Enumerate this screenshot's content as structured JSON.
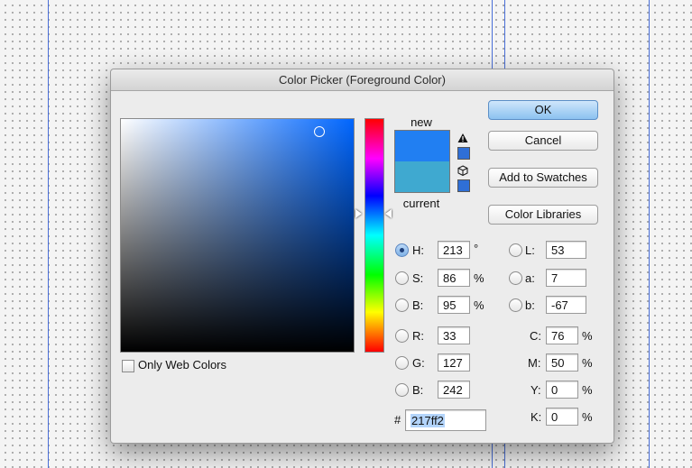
{
  "dialog": {
    "title": "Color Picker (Foreground Color)",
    "colors": {
      "new": "#217ff2",
      "current": "#3fa9d0",
      "gamut_swatch": "#2f6fd6",
      "web_swatch": "#2f6fd6"
    }
  },
  "preview": {
    "new_label": "new",
    "current_label": "current",
    "warning_icon": "warning-triangle-icon",
    "web_icon": "cube-icon"
  },
  "buttons": {
    "ok": "OK",
    "cancel": "Cancel",
    "add_to_swatches": "Add to Swatches",
    "color_libraries": "Color Libraries"
  },
  "only_web_colors": {
    "label": "Only Web Colors",
    "checked": false
  },
  "hsb": {
    "h": {
      "label": "H:",
      "value": "213",
      "unit": "°",
      "selected": true
    },
    "s": {
      "label": "S:",
      "value": "86",
      "unit": "%"
    },
    "b": {
      "label": "B:",
      "value": "95",
      "unit": "%"
    }
  },
  "rgb": {
    "r": {
      "label": "R:",
      "value": "33"
    },
    "g": {
      "label": "G:",
      "value": "127"
    },
    "b": {
      "label": "B:",
      "value": "242"
    }
  },
  "lab": {
    "l": {
      "label": "L:",
      "value": "53"
    },
    "a": {
      "label": "a:",
      "value": "7"
    },
    "b": {
      "label": "b:",
      "value": "-67"
    }
  },
  "cmyk": {
    "c": {
      "label": "C:",
      "value": "76",
      "unit": "%"
    },
    "m": {
      "label": "M:",
      "value": "50",
      "unit": "%"
    },
    "y": {
      "label": "Y:",
      "value": "0",
      "unit": "%"
    },
    "k": {
      "label": "K:",
      "value": "0",
      "unit": "%"
    }
  },
  "hex": {
    "label": "#",
    "value": "217ff2"
  }
}
